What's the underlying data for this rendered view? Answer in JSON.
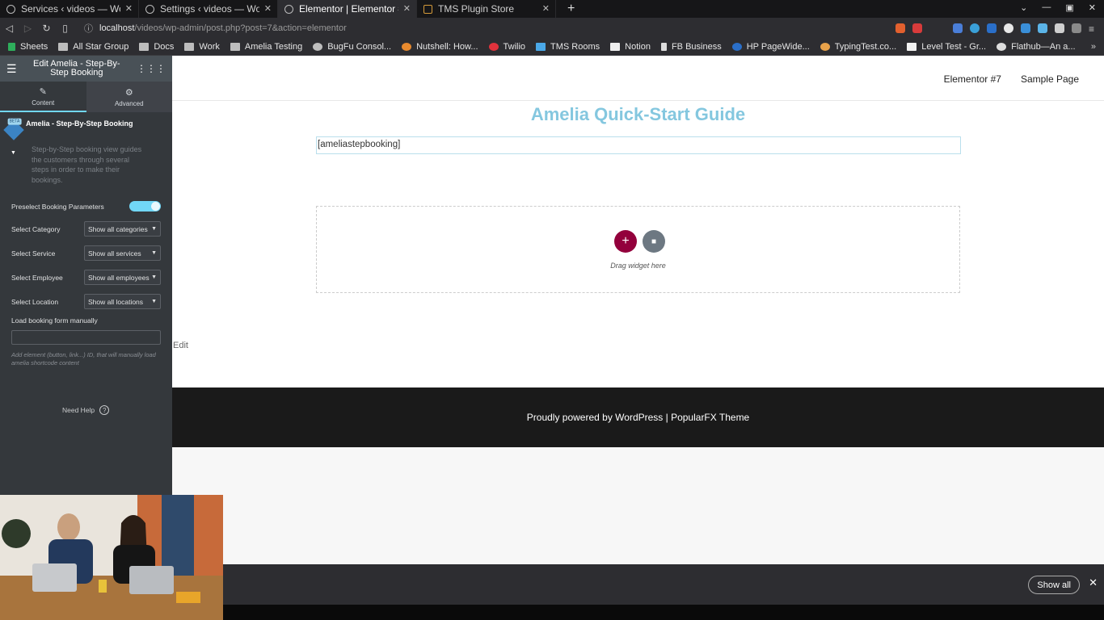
{
  "browser": {
    "tabs": [
      {
        "title": "Services ‹ videos — WordPress",
        "active": false
      },
      {
        "title": "Settings ‹ videos — WordPress",
        "active": false
      },
      {
        "title": "Elementor | Elementor #7",
        "active": true
      },
      {
        "title": "TMS Plugin Store",
        "active": false
      }
    ],
    "url_host": "localhost",
    "url_path": "/videos/wp-admin/post.php?post=7&action=elementor",
    "bookmarks": [
      "Sheets",
      "All Star Group",
      "Docs",
      "Work",
      "Amelia Testing",
      "BugFu Consol...",
      "Nutshell: How...",
      "Twilio",
      "TMS Rooms",
      "Notion",
      "FB Business",
      "HP PageWide...",
      "TypingTest.co...",
      "Level Test - Gr...",
      "Flathub—An a..."
    ]
  },
  "panel": {
    "title": "Edit Amelia - Step-By-Step Booking",
    "tabs": {
      "content": "Content",
      "advanced": "Advanced"
    },
    "widget": {
      "badge": "BETA",
      "title": "Amelia - Step-By-Step Booking",
      "description": "Step-by-Step booking view guides the customers through several steps in order to make their bookings."
    },
    "preselect_label": "Preselect Booking Parameters",
    "fields": [
      {
        "label": "Select Category",
        "value": "Show all categories"
      },
      {
        "label": "Select Service",
        "value": "Show all services"
      },
      {
        "label": "Select Employee",
        "value": "Show all employees"
      },
      {
        "label": "Select Location",
        "value": "Show all locations"
      }
    ],
    "load_label": "Load booking form manually",
    "load_help": "Add element (button, link...) ID, that will manually load amelia shortcode content",
    "need_help": "Need Help"
  },
  "preview": {
    "nav": [
      "Elementor #7",
      "Sample Page"
    ],
    "title": "Amelia Quick-Start Guide",
    "shortcode": "[ameliastepbooking]",
    "drag_text": "Drag widget here",
    "edit_link": "Edit",
    "footer": "Proudly powered by WordPress | PopularFX Theme"
  },
  "download_bar": {
    "show_all": "Show all"
  },
  "colors": {
    "accent": "#71d7f7",
    "title": "#84c7df",
    "add_button": "#93003c"
  }
}
